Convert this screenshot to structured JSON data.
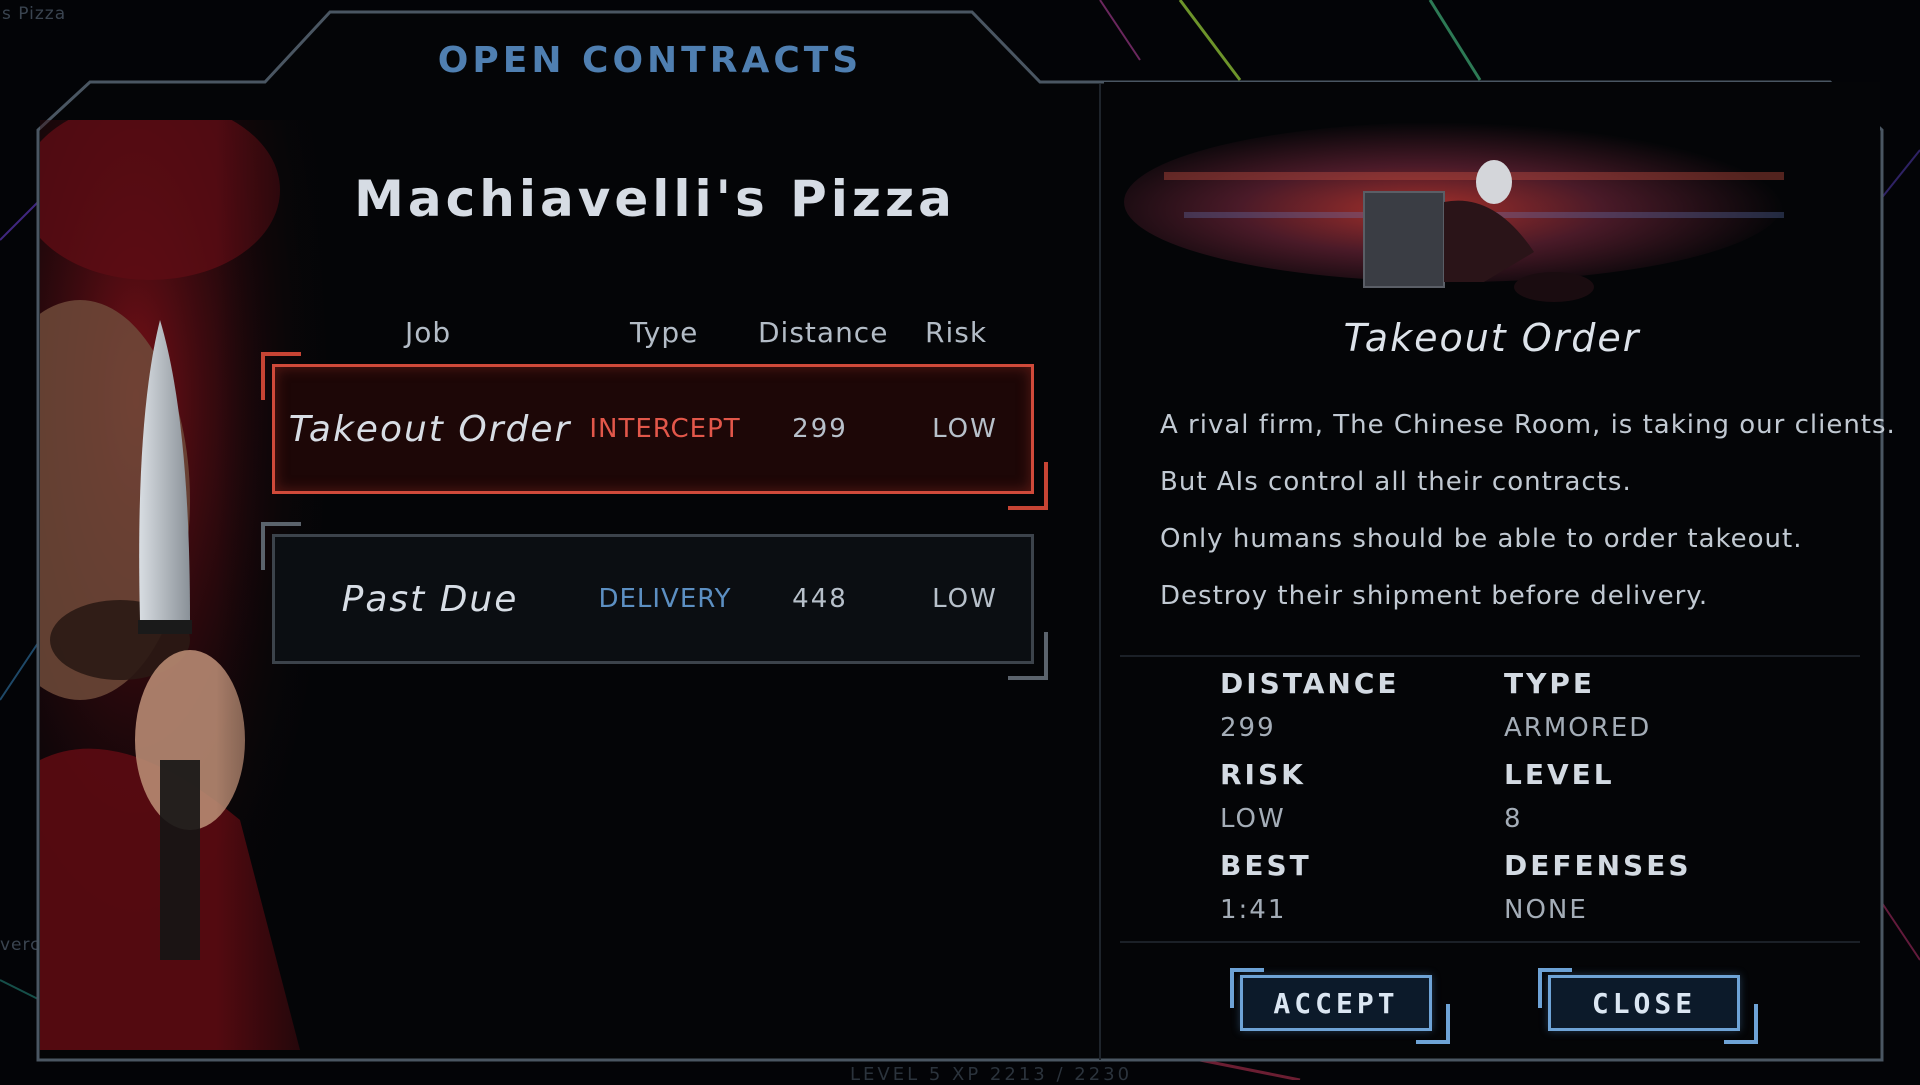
{
  "background": {
    "corner_text": "s Pizza",
    "left_edge_text": "verc",
    "footer_text": "LEVEL 5   XP 2213 / 2230"
  },
  "panel": {
    "title": "OPEN CONTRACTS",
    "company": "Machiavelli's Pizza"
  },
  "table": {
    "headers": {
      "job": "Job",
      "type": "Type",
      "distance": "Distance",
      "risk": "Risk"
    },
    "rows": [
      {
        "job": "Takeout Order",
        "type": "INTERCEPT",
        "distance": "299",
        "risk": "LOW",
        "selected": true
      },
      {
        "job": "Past Due",
        "type": "DELIVERY",
        "distance": "448",
        "risk": "LOW",
        "selected": false
      }
    ]
  },
  "detail": {
    "title": "Takeout Order",
    "description": [
      "A rival firm, The Chinese Room, is taking our clients.",
      "But AIs control all their contracts.",
      "Only humans should be able to order takeout.",
      "Destroy their shipment before delivery."
    ],
    "stats": {
      "distance_label": "DISTANCE",
      "distance_value": "299",
      "type_label": "TYPE",
      "type_value": "ARMORED",
      "risk_label": "RISK",
      "risk_value": "LOW",
      "level_label": "LEVEL",
      "level_value": "8",
      "best_label": "BEST",
      "best_value": "1:41",
      "defenses_label": "DEFENSES",
      "defenses_value": "NONE"
    }
  },
  "buttons": {
    "accept": "ACCEPT",
    "close": "CLOSE"
  },
  "colors": {
    "accent_blue": "#4f7fb1",
    "intercept_red": "#e2574a",
    "delivery_blue": "#5c8fc2",
    "frame": "#4a5662"
  }
}
